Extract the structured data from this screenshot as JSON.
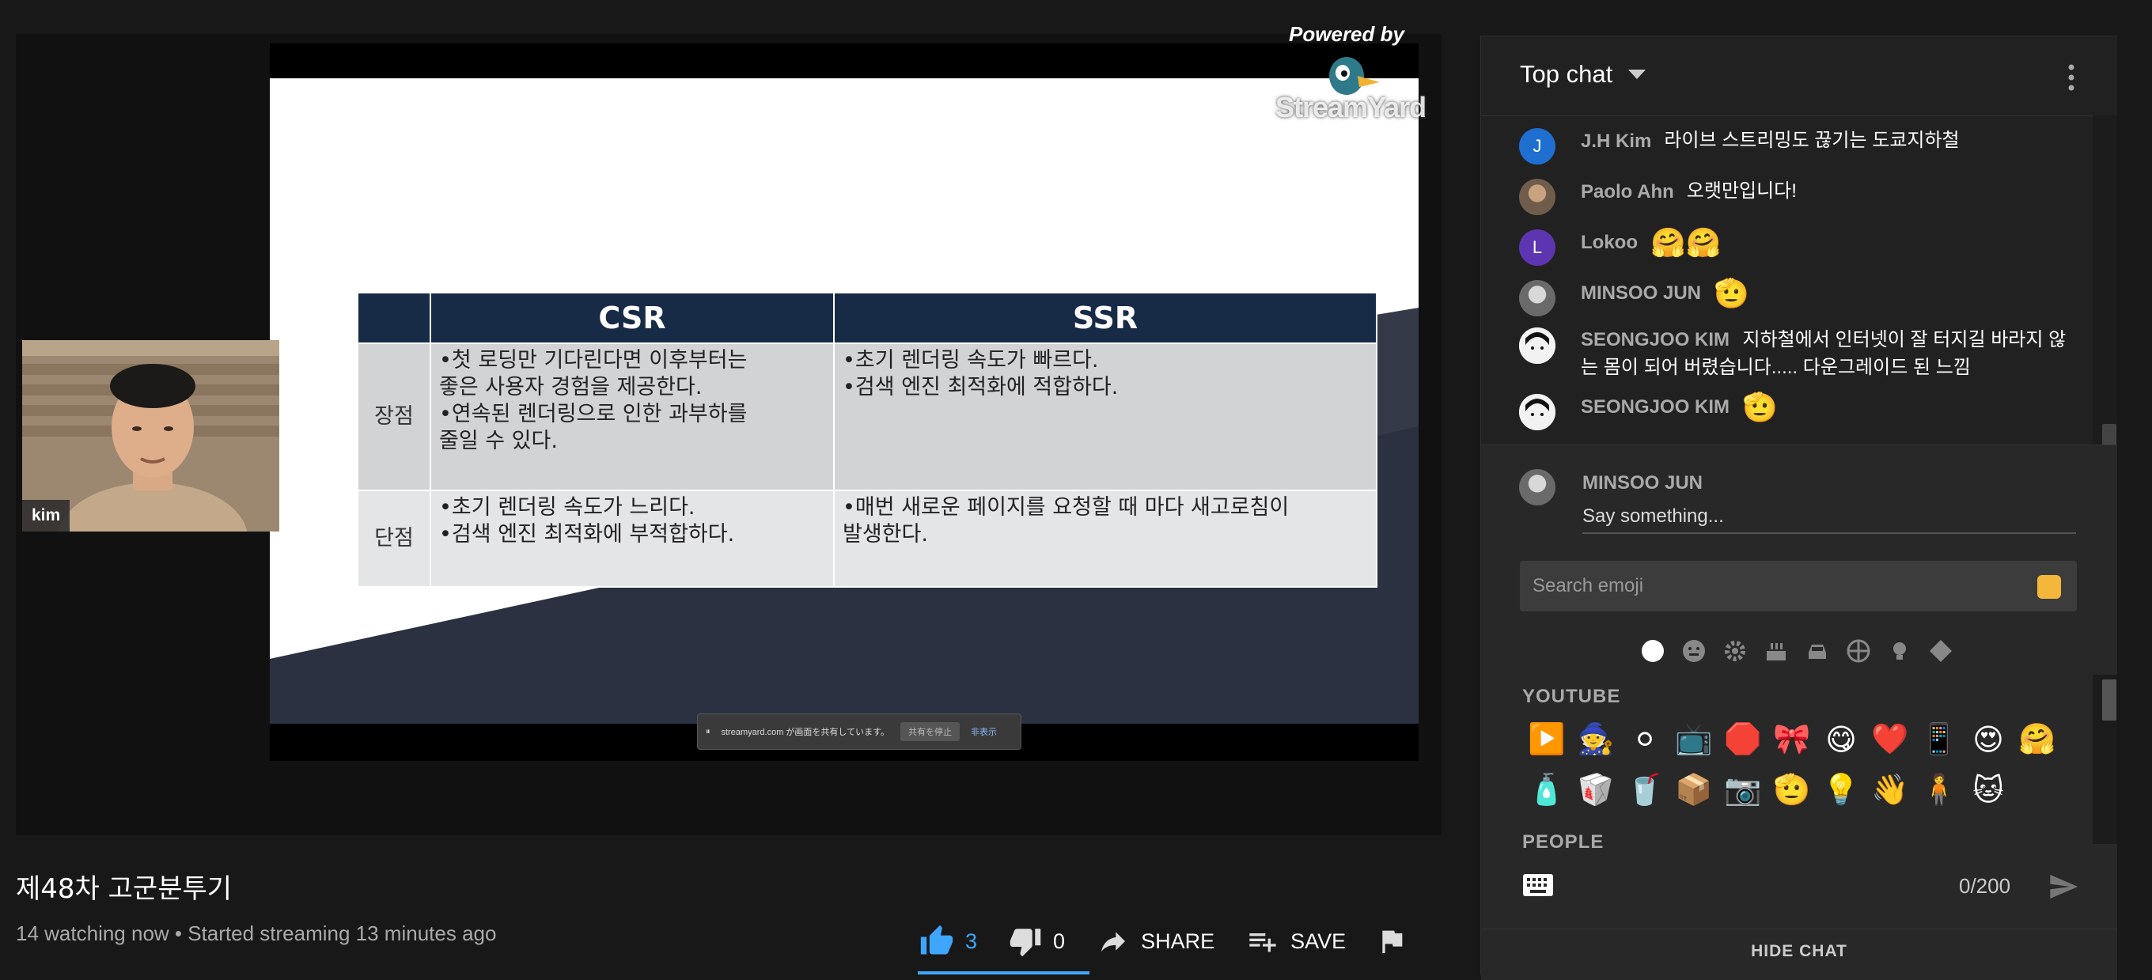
{
  "video": {
    "powered_by": "Powered by",
    "streamyard": "StreamYard",
    "slide_table": {
      "headers": [
        "",
        "CSR",
        "SSR"
      ],
      "rows": [
        {
          "label": "장점",
          "csr": [
            "•첫 로딩만 기다린다면 이후부터는",
            "좋은 사용자 경험을 제공한다.",
            "•연속된 렌더링으로 인한 과부하를",
            "줄일 수 있다."
          ],
          "ssr": [
            "•초기 렌더링 속도가 빠르다.",
            "•검색 엔진 최적화에 적합하다."
          ]
        },
        {
          "label": "단점",
          "csr": [
            "•초기 렌더링 속도가 느리다.",
            "•검색 엔진 최적화에 부적합하다."
          ],
          "ssr": [
            "•매번 새로운 페이지를 요청할 때 마다 새고로침이",
            "발생한다."
          ]
        }
      ]
    },
    "share_notice": {
      "text": "streamyard.com が画面を共有しています。",
      "stop": "共有を停止",
      "hide": "非表示"
    },
    "webcam_label": "kim"
  },
  "title": "제48차 고군분투기",
  "meta": "14 watching now • Started streaming 13 minutes ago",
  "actions": {
    "like_count": "3",
    "dislike_count": "0",
    "share_label": "SHARE",
    "save_label": "SAVE"
  },
  "chat": {
    "title": "Top chat",
    "messages": [
      {
        "author": "J.H Kim",
        "initial": "J",
        "avatar_color": "#1e6fcf",
        "text": "라이브 스트리밍도 끊기는 도쿄지하철"
      },
      {
        "author": "Paolo Ahn",
        "initial": "",
        "avatar_color": "#7b6a55",
        "text": "오랫만입니다!"
      },
      {
        "author": "Lokoo",
        "initial": "L",
        "avatar_color": "#5e35b1",
        "text": "",
        "emojis": "🤗🤗"
      },
      {
        "author": "MINSOO JUN",
        "initial": "",
        "avatar_color": "#8d8d8d",
        "text": "",
        "emojis": "🫡"
      },
      {
        "author": "SEONGJOO KIM",
        "initial": "",
        "avatar_color": "#eeeeee",
        "text": "지하철에서 인터넷이 잘 터지길 바라지 않는 몸이 되어 버렸습니다..... 다운그레이드 된 느낌"
      },
      {
        "author": "SEONGJOO KIM",
        "initial": "",
        "avatar_color": "#eeeeee",
        "text": "",
        "emojis": "🫡"
      }
    ],
    "composer": {
      "name": "MINSOO JUN",
      "placeholder": "Say something...",
      "emoji_search_placeholder": "Search emoji",
      "section_youtube": "YOUTUBE",
      "section_people": "PEOPLE",
      "char_count": "0/200"
    },
    "emoji_categories": [
      "circle-icon",
      "smile-icon",
      "gear-icon",
      "cake-icon",
      "car-icon",
      "basketball-icon",
      "bulb-icon",
      "diamond-icon"
    ],
    "emojis": [
      "▶️",
      "🧙",
      "⚪",
      "📺",
      "🛑",
      "🎀",
      "😋",
      "❤️",
      "📱",
      "😍",
      "🤗",
      "🧴",
      "🥡",
      "🥤",
      "📦",
      "📷",
      "🫡",
      "💡",
      "👋",
      "🧍",
      "🐱"
    ],
    "hide_chat": "HIDE CHAT"
  }
}
